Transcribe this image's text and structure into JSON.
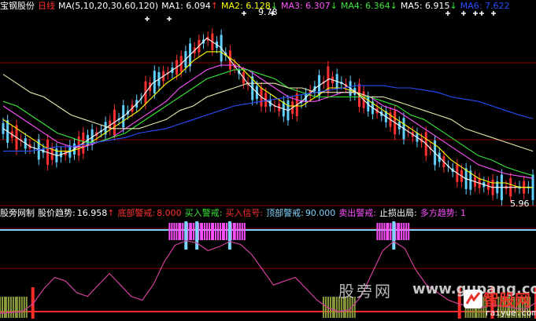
{
  "colors": {
    "background": "#000000",
    "grid": "#8b0000",
    "white": "#ffffff",
    "yellow": "#ffff00",
    "magenta": "#ff50ff",
    "green": "#39e639",
    "cyan": "#7fd4ff",
    "blue": "#2a4dff",
    "red": "#ff2b2b",
    "olive": "#8c9c3c",
    "candle_up": "#ff3030",
    "candle_down": "#5fd0ff"
  },
  "top_panel": {
    "stock_name": "宝钢股份",
    "period": "日线",
    "ma_def": "MA(5,10,20,30,60,120)",
    "ma1": "MA1: 6.094",
    "ma1_arrow": "↑",
    "ma2": "MA2: 6.128",
    "ma2_arrow": "↓",
    "ma3": "MA3: 6.307",
    "ma3_arrow": "↓",
    "ma4": "MA4: 6.364",
    "ma4_arrow": "↓",
    "ma5": "MA5: 6.915",
    "ma5_arrow": "↓",
    "ma6": "MA6: 7.622",
    "high_label": "9.78",
    "low_label": "5.96"
  },
  "bottom_panel": {
    "indicator_name": "股旁网制",
    "trend_label": "股价趋势:",
    "trend_value": "16.958",
    "trend_arrow": "↑",
    "bottom_warn_label": "底部警戒:",
    "bottom_warn_value": "8.000",
    "buy_warn_label": "买入警戒:",
    "buy_signal_label": "买入信号:",
    "top_warn_label": "顶部警戒:",
    "top_warn_value": "90.000",
    "sell_warn_label": "卖出警戒:",
    "stop_loss_label": "止损出局:",
    "bull_trend_label": "多方趋势: 1"
  },
  "watermark": {
    "site_cn": "股旁网",
    "site_url": "www.gupang.com",
    "logo_cn": "智股网",
    "logo_url": "raiyue.com"
  },
  "chart_data": [
    {
      "type": "line",
      "series": [
        {
          "name": "MA1",
          "values": [
            7.4,
            7.2,
            7.0,
            6.9,
            6.8,
            6.9,
            7.1,
            7.3,
            7.5,
            7.7,
            8.0,
            8.4,
            8.6,
            8.8,
            9.1,
            9.4,
            9.2,
            8.8,
            8.4,
            8.1,
            7.9,
            7.8,
            8.0,
            8.3,
            8.5,
            8.4,
            8.2,
            7.9,
            7.7,
            7.5,
            7.3,
            7.1,
            6.8,
            6.5,
            6.3,
            6.2,
            6.1,
            6.1,
            6.1,
            6.1
          ]
        },
        {
          "name": "MA2",
          "values": [
            7.6,
            7.4,
            7.2,
            7.0,
            6.9,
            6.9,
            7.0,
            7.2,
            7.4,
            7.6,
            7.8,
            8.1,
            8.4,
            8.6,
            8.9,
            9.1,
            9.1,
            8.9,
            8.6,
            8.3,
            8.1,
            7.9,
            7.9,
            8.1,
            8.3,
            8.3,
            8.2,
            8.0,
            7.8,
            7.6,
            7.4,
            7.2,
            7.0,
            6.7,
            6.5,
            6.3,
            6.2,
            6.2,
            6.1,
            6.1
          ]
        },
        {
          "name": "MA3",
          "values": [
            7.9,
            7.7,
            7.5,
            7.3,
            7.1,
            7.0,
            7.0,
            7.1,
            7.2,
            7.4,
            7.6,
            7.8,
            8.0,
            8.3,
            8.5,
            8.7,
            8.8,
            8.8,
            8.7,
            8.5,
            8.3,
            8.1,
            8.0,
            8.0,
            8.1,
            8.2,
            8.2,
            8.1,
            7.9,
            7.8,
            7.6,
            7.4,
            7.2,
            7.0,
            6.8,
            6.6,
            6.5,
            6.4,
            6.35,
            6.3
          ]
        },
        {
          "name": "MA4",
          "values": [
            8.0,
            7.9,
            7.7,
            7.5,
            7.3,
            7.2,
            7.1,
            7.1,
            7.2,
            7.3,
            7.5,
            7.7,
            7.9,
            8.1,
            8.3,
            8.5,
            8.6,
            8.7,
            8.7,
            8.6,
            8.5,
            8.3,
            8.2,
            8.1,
            8.1,
            8.1,
            8.1,
            8.1,
            8.0,
            7.9,
            7.7,
            7.6,
            7.4,
            7.2,
            7.0,
            6.8,
            6.7,
            6.55,
            6.45,
            6.36
          ]
        },
        {
          "name": "MA5",
          "values": [
            8.6,
            8.4,
            8.2,
            8.1,
            7.9,
            7.7,
            7.6,
            7.5,
            7.4,
            7.4,
            7.4,
            7.5,
            7.6,
            7.8,
            7.9,
            8.1,
            8.2,
            8.3,
            8.4,
            8.4,
            8.4,
            8.3,
            8.3,
            8.2,
            8.2,
            8.2,
            8.2,
            8.1,
            8.1,
            8.0,
            7.9,
            7.8,
            7.7,
            7.6,
            7.4,
            7.3,
            7.2,
            7.1,
            7.0,
            6.9
          ]
        },
        {
          "name": "MA6",
          "values": [
            6.9,
            6.9,
            6.9,
            6.95,
            7.0,
            7.0,
            7.05,
            7.1,
            7.15,
            7.2,
            7.3,
            7.35,
            7.4,
            7.5,
            7.6,
            7.7,
            7.8,
            7.9,
            7.95,
            8.0,
            8.05,
            8.1,
            8.15,
            8.2,
            8.25,
            8.3,
            8.35,
            8.35,
            8.35,
            8.3,
            8.3,
            8.25,
            8.2,
            8.1,
            8.05,
            8.0,
            7.9,
            7.8,
            7.7,
            7.62
          ]
        }
      ],
      "ylim": [
        5.8,
        10.0
      ]
    },
    {
      "type": "line",
      "series": [
        {
          "name": "股价趋势",
          "values": [
            3,
            4,
            5,
            15,
            35,
            50,
            45,
            30,
            25,
            40,
            55,
            40,
            25,
            20,
            40,
            70,
            92,
            98,
            95,
            85,
            90,
            97,
            93,
            80,
            60,
            40,
            45,
            50,
            35,
            20,
            10,
            5,
            8,
            25,
            55,
            85,
            97,
            88,
            60,
            40,
            30,
            20,
            15,
            12,
            10,
            14,
            12,
            10,
            8,
            17
          ]
        }
      ],
      "ylim": [
        0,
        110
      ]
    }
  ]
}
